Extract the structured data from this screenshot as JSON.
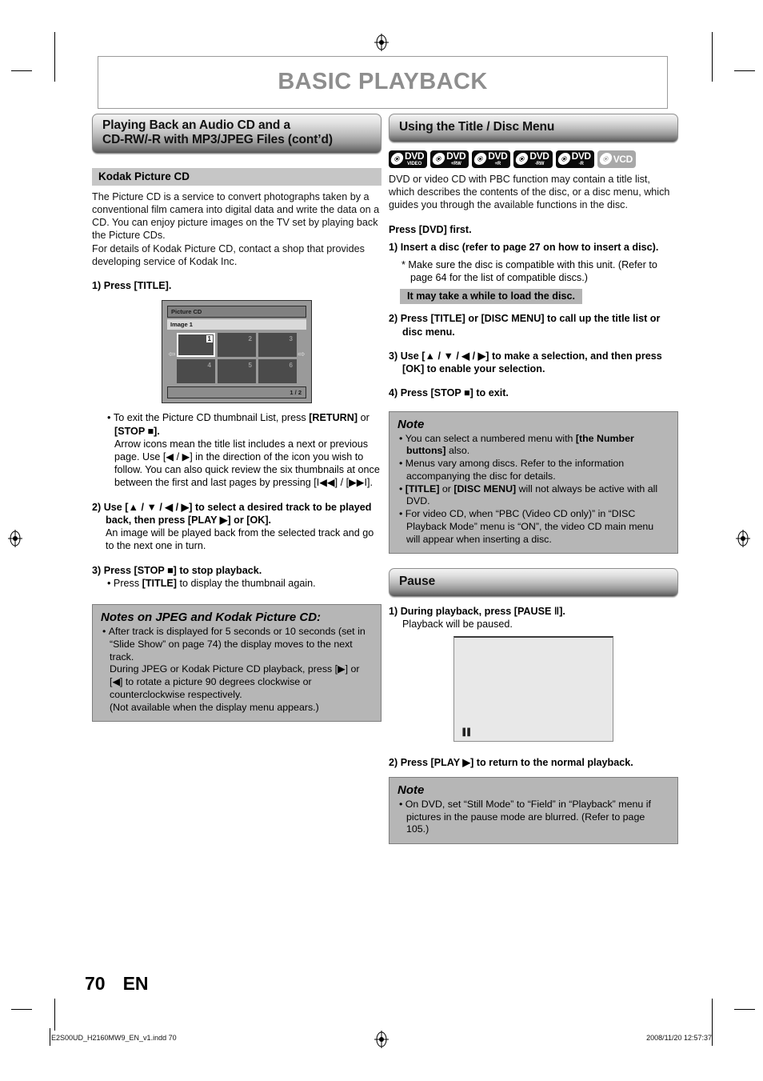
{
  "page": {
    "running_head": "BASIC PLAYBACK",
    "page_number": "70",
    "language_code": "EN"
  },
  "footer": {
    "file_name": "E2S00UD_H2160MW9_EN_v1.indd   70",
    "timestamp": "2008/11/20   12:57:37"
  },
  "left_column": {
    "section_title_line1": "Playing Back an Audio CD and a",
    "section_title_line2": "CD-RW/-R with MP3/JPEG Files (cont’d)",
    "subsection_title": "Kodak Picture CD",
    "intro_paragraph_1": "The Picture CD is a service to convert photographs taken by a conventional film camera into digital data and write the data on a CD. You can enjoy picture images on the TV set by playing back the Picture CDs.",
    "intro_paragraph_2": "For details of Kodak Picture CD, contact a shop that provides developing service of Kodak Inc.",
    "step1": "1) Press [TITLE].",
    "screen_mock": {
      "title": "Picture CD",
      "subtitle": "Image 1",
      "thumbnails": [
        "1",
        "2",
        "3",
        "4",
        "5",
        "6"
      ],
      "selected_index": 0,
      "left_arrow": "⇦",
      "right_arrow": "⇨",
      "page_indicator": "1 / 2"
    },
    "bullet_exit_bold_1": "To exit the Picture CD thumbnail List, press ",
    "bullet_exit_bold_2": "[RETURN]",
    "bullet_exit_bold_3": " or ",
    "bullet_exit_bold_4": "[STOP ■].",
    "bullet_arrow_text": "Arrow icons mean the title list includes a next or previous page. Use [◀ / ▶] in the direction of the icon you wish to follow. You can also quick review the six thumbnails at once between the first and last pages by pressing [I◀◀] / [▶▶I].",
    "step2": "2) Use [▲ / ▼ / ◀ / ▶] to select a desired track to be played back, then press [PLAY ▶] or [OK].",
    "step2_body": "An image will be played back from the selected track and go to the next one in turn.",
    "step3": "3) Press [STOP ■] to stop playback.",
    "step3_bullet_1": "Press ",
    "step3_bullet_2": "[TITLE]",
    "step3_bullet_3": " to display the thumbnail again.",
    "notes_title": "Notes on JPEG and Kodak Picture CD:",
    "notes_bullet_1": "After track is displayed for 5 seconds or 10 seconds (set in “Slide Show” on page 74) the display moves to the next track.",
    "notes_para_2": "During JPEG or Kodak Picture CD playback, press [▶] or [◀] to rotate a picture 90 degrees clockwise or counterclockwise respectively.",
    "notes_para_3": "(Not available when the display menu appears.)"
  },
  "right_column": {
    "section_title": "Using the Title / Disc Menu",
    "disc_badges": [
      {
        "name": "DVD",
        "sub": "VIDEO",
        "style": "dark"
      },
      {
        "name": "DVD",
        "sub": "+RW",
        "style": "dark"
      },
      {
        "name": "DVD",
        "sub": "+R",
        "style": "dark"
      },
      {
        "name": "DVD",
        "sub": "-RW",
        "style": "dark"
      },
      {
        "name": "DVD",
        "sub": "-R",
        "style": "dark"
      },
      {
        "name": "VCD",
        "sub": "",
        "style": "gray"
      }
    ],
    "intro_paragraph": "DVD or video CD with PBC function may contain a title list, which describes the contents of the disc, or a disc menu, which guides you through the available functions in the disc.",
    "press_dvd_first": "Press [DVD] first.",
    "step1": "1) Insert a disc (refer to page 27 on how to insert a disc).",
    "step1_star": "* Make sure the disc is compatible with this unit. (Refer to page 64 for the list of compatible discs.)",
    "step1_highlight": "It may take a while to load the disc.",
    "step2": "2) Press [TITLE] or [DISC MENU] to call up the title list or disc menu.",
    "step3": "3) Use [▲ / ▼ / ◀ / ▶] to make a selection, and then press [OK] to enable your selection.",
    "step4": "4) Press [STOP ■] to exit.",
    "note_title": "Note",
    "note_b1_a": "You can select a numbered menu with ",
    "note_b1_b": "[the Number buttons]",
    "note_b1_c": " also.",
    "note_b2": "Menus vary among discs. Refer to the information accompanying the disc for details.",
    "note_b3_a": "[TITLE]",
    "note_b3_b": " or ",
    "note_b3_c": "[DISC MENU]",
    "note_b3_d": " will not always be active with all DVD.",
    "note_b4": "For video CD, when “PBC (Video CD only)” in “DISC Playback Mode” menu is “ON”, the video CD main menu will appear when inserting a disc.",
    "pause_section_title": "Pause",
    "pause_step1": "1) During playback, press [PAUSE ‖].",
    "pause_step1_body": "Playback will be paused.",
    "pause_screen_icon": "▐▐",
    "pause_step2": "2) Press [PLAY ▶] to return to the normal playback.",
    "pause_note_title": "Note",
    "pause_note_bullet": "On DVD, set “Still Mode” to “Field” in “Playback” menu if pictures in the pause mode are blurred. (Refer to page 105.)"
  }
}
